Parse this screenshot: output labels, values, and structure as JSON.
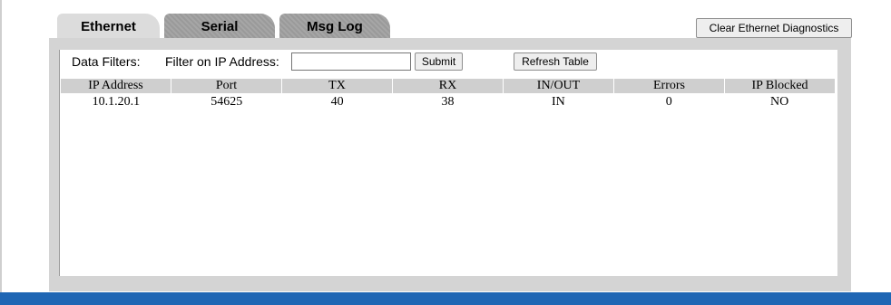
{
  "tabs": [
    {
      "label": "Ethernet",
      "active": true
    },
    {
      "label": "Serial",
      "active": false
    },
    {
      "label": "Msg Log",
      "active": false
    }
  ],
  "clear_button_label": "Clear Ethernet Diagnostics",
  "filters": {
    "label": "Data Filters:",
    "ip_filter_label": "Filter on IP Address:",
    "ip_filter_value": "",
    "submit_label": "Submit",
    "refresh_label": "Refresh Table"
  },
  "table": {
    "columns": [
      "IP Address",
      "Port",
      "TX",
      "RX",
      "IN/OUT",
      "Errors",
      "IP Blocked"
    ],
    "rows": [
      [
        "10.1.20.1",
        "54625",
        "40",
        "38",
        "IN",
        "0",
        "NO"
      ]
    ]
  },
  "colors": {
    "active_tab": "#dcdcdc",
    "inactive_tab": "#a0a0a0",
    "panel": "#d4d4d4",
    "table_header": "#cfcfcf",
    "footer_bar": "#1f66b4"
  }
}
